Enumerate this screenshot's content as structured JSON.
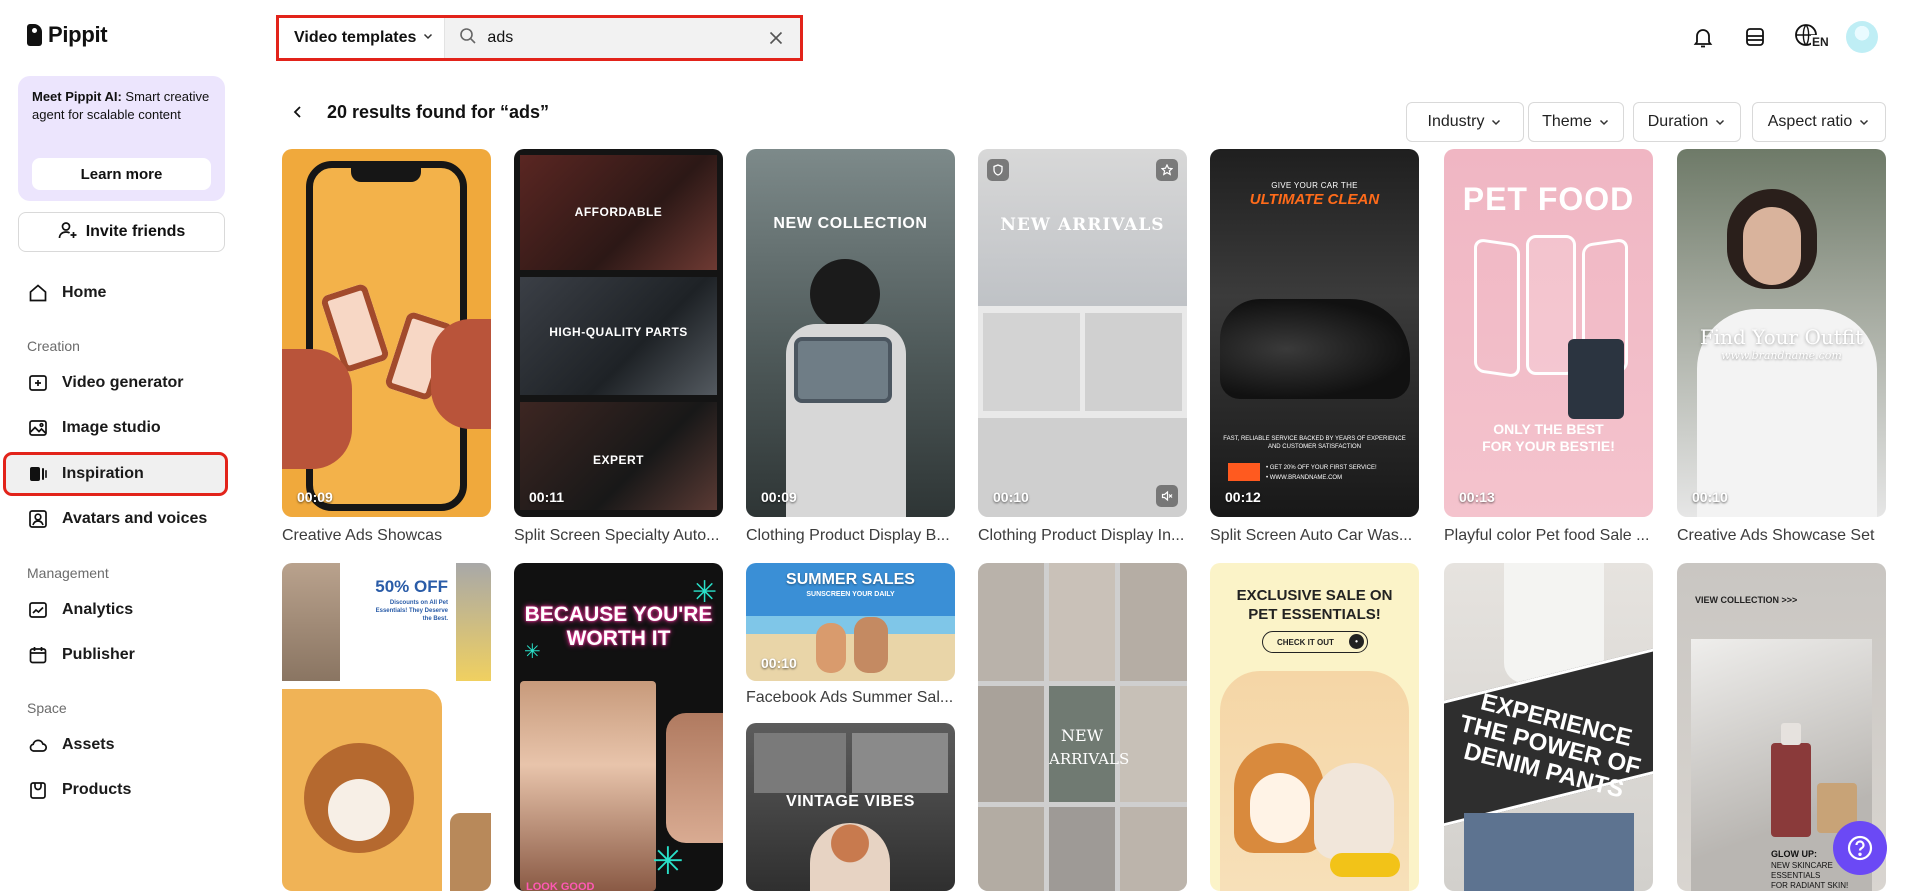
{
  "app": {
    "name": "Pippit"
  },
  "promo": {
    "title": "Meet Pippit AI:",
    "text": " Smart creative agent for scalable content",
    "button": "Learn more"
  },
  "sidebar": {
    "invite": "Invite friends",
    "home": "Home",
    "section_creation": "Creation",
    "video_generator": "Video generator",
    "image_studio": "Image studio",
    "inspiration": "Inspiration",
    "avatars_voices": "Avatars and voices",
    "section_management": "Management",
    "analytics": "Analytics",
    "publisher": "Publisher",
    "section_space": "Space",
    "assets": "Assets",
    "products": "Products"
  },
  "search": {
    "category": "Video templates",
    "query": "ads"
  },
  "header": {
    "language": "EN"
  },
  "results": {
    "title": "20 results found for “ads”"
  },
  "filters": [
    "Industry",
    "Theme",
    "Duration",
    "Aspect ratio"
  ],
  "cards": [
    {
      "label": "Creative Ads Showcas",
      "duration": "00:09"
    },
    {
      "label": "Split Screen Specialty Auto...",
      "duration": "00:11",
      "texts": [
        "AFFORDABLE",
        "HIGH-QUALITY PARTS",
        "EXPERT"
      ]
    },
    {
      "label": "Clothing Product Display B...",
      "duration": "00:09",
      "texts": [
        "NEW COLLECTION"
      ]
    },
    {
      "label": "Clothing Product Display In...",
      "duration": "00:10",
      "texts": [
        "NEW ARRIVALS"
      ]
    },
    {
      "label": "Split Screen Auto Car Was...",
      "duration": "00:12",
      "texts": [
        "GIVE YOUR CAR THE",
        "ULTIMATE CLEAN",
        "FAST, RELIABLE SERVICE BACKED BY YEARS OF EXPERIENCE AND CUSTOMER SATISFACTION",
        "• GET 20% OFF YOUR FIRST SERVICE!",
        "• WWW.BRANDNAME.COM"
      ]
    },
    {
      "label": "Playful color Pet food Sale ...",
      "duration": "00:13",
      "texts": [
        "PET FOOD",
        "ONLY THE BEST",
        "FOR YOUR BESTIE!"
      ]
    },
    {
      "label": "Creative Ads Showcase Set",
      "duration": "00:10",
      "texts": [
        "Find Your Outfit",
        "www.brandname.com"
      ]
    },
    {
      "texts": [
        "50% OFF",
        "Discounts on All Pet Essentials! They Deserve the Best."
      ]
    },
    {
      "texts": [
        "BECAUSE YOU'RE",
        "WORTH IT",
        "LOOK GOOD"
      ]
    },
    {
      "label": "Facebook Ads Summer Sal...",
      "duration": "00:10",
      "texts": [
        "SUMMER SALES",
        "SUNSCREEN YOUR DAILY"
      ]
    },
    {
      "texts": [
        "VINTAGE VIBES"
      ]
    },
    {
      "texts": [
        "NEW",
        "ARRIVALS"
      ]
    },
    {
      "texts": [
        "EXCLUSIVE SALE ON",
        "PET ESSENTIALS!",
        "CHECK IT OUT"
      ]
    },
    {
      "texts": [
        "EXPERIENCE",
        "THE POWER OF",
        "DENIM PANTS"
      ]
    },
    {
      "texts": [
        "VIEW COLLECTION >>>",
        "GLOW UP:",
        "NEW SKINCARE",
        "ESSENTIALS",
        "FOR RADIANT SKIN!"
      ]
    }
  ],
  "colors": {
    "accent": "#6b49f5",
    "highlight": "#e2231a",
    "promo_bg": "#ece5fd"
  }
}
